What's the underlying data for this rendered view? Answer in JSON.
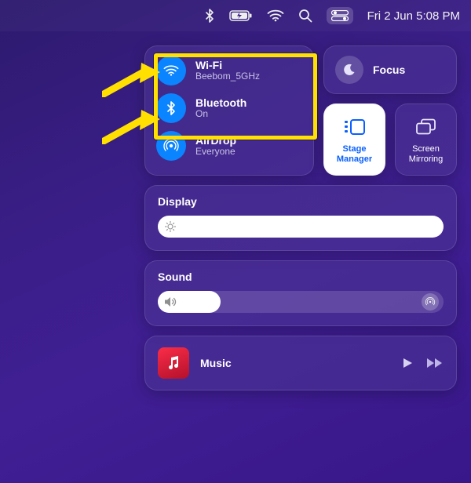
{
  "menubar": {
    "datetime": "Fri 2 Jun  5:08 PM"
  },
  "connectivity": {
    "wifi": {
      "title": "Wi-Fi",
      "sub": "Beebom_5GHz"
    },
    "bluetooth": {
      "title": "Bluetooth",
      "sub": "On"
    },
    "airdrop": {
      "title": "AirDrop",
      "sub": "Everyone"
    }
  },
  "focus": {
    "label": "Focus"
  },
  "stage_manager": {
    "label": "Stage\nManager"
  },
  "screen_mirroring": {
    "label": "Screen\nMirroring"
  },
  "display": {
    "label": "Display",
    "value": 100
  },
  "sound": {
    "label": "Sound",
    "value": 22
  },
  "music": {
    "label": "Music"
  }
}
